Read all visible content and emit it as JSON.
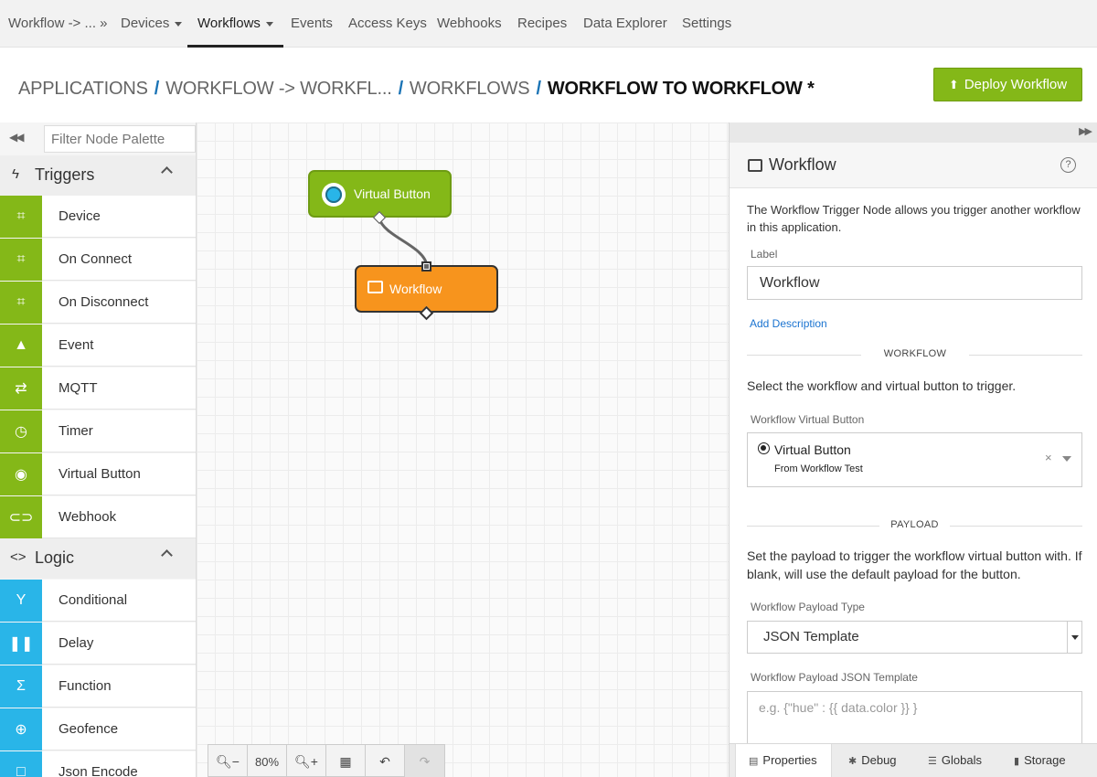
{
  "nav": {
    "items": [
      {
        "label": "Workflow -> ... »",
        "caret": false
      },
      {
        "label": "Devices",
        "caret": true
      },
      {
        "label": "Workflows",
        "caret": true,
        "active": true
      },
      {
        "label": "Events",
        "caret": false
      },
      {
        "label": "Access Keys",
        "caret": false
      },
      {
        "label": "Webhooks",
        "caret": false
      },
      {
        "label": "Recipes",
        "caret": false
      },
      {
        "label": "Data Explorer",
        "caret": false
      },
      {
        "label": "Settings",
        "caret": false
      }
    ]
  },
  "breadcrumb": {
    "items": [
      "APPLICATIONS",
      "WORKFLOW -> WORKFL...",
      "WORKFLOWS"
    ],
    "separator": "/",
    "current": "WORKFLOW TO WORKFLOW *"
  },
  "deploy_button": {
    "label": "Deploy Workflow",
    "icon": "upload-icon"
  },
  "palette": {
    "filter_placeholder": "Filter Node Palette",
    "sections": [
      {
        "title": "Triggers",
        "icon": "lightning-icon",
        "color": "#84b818",
        "items": [
          {
            "label": "Device",
            "icon": "chip-icon"
          },
          {
            "label": "On Connect",
            "icon": "chip-icon"
          },
          {
            "label": "On Disconnect",
            "icon": "chip-icon"
          },
          {
            "label": "Event",
            "icon": "warning-icon"
          },
          {
            "label": "MQTT",
            "icon": "arrows-exchange-icon"
          },
          {
            "label": "Timer",
            "icon": "stopwatch-icon"
          },
          {
            "label": "Virtual Button",
            "icon": "radio-dot-icon"
          },
          {
            "label": "Webhook",
            "icon": "link-icon"
          }
        ]
      },
      {
        "title": "Logic",
        "icon": "code-brackets-icon",
        "color": "#29b5e8",
        "items": [
          {
            "label": "Conditional",
            "icon": "branch-icon"
          },
          {
            "label": "Delay",
            "icon": "pause-icon"
          },
          {
            "label": "Function",
            "icon": "sigma-icon"
          },
          {
            "label": "Geofence",
            "icon": "crosshair-icon"
          },
          {
            "label": "Json Encode",
            "icon": "box-icon"
          }
        ]
      }
    ]
  },
  "canvas": {
    "nodes": [
      {
        "label": "Virtual Button",
        "color": "#84b818",
        "icon": "radio-dot-icon"
      },
      {
        "label": "Workflow",
        "color": "#f7941d",
        "icon": "workflow-enter-icon"
      }
    ],
    "toolbar": {
      "zoom": "80%"
    }
  },
  "panel": {
    "title": "Workflow",
    "description": "The Workflow Trigger Node allows you trigger another workflow in this application.",
    "label_field": {
      "label": "Label",
      "value": "Workflow"
    },
    "add_description": "Add Description",
    "workflow_divider": "WORKFLOW",
    "workflow_help": "Select the workflow and virtual button to trigger.",
    "virtual_button_field": {
      "label": "Workflow Virtual Button",
      "value": "Virtual Button",
      "sublabel": "From Workflow Test",
      "clear": "×"
    },
    "payload_divider": "PAYLOAD",
    "payload_help": "Set the payload to trigger the workflow virtual button with. If blank, will use the default payload for the button.",
    "payload_type_field": {
      "label": "Workflow Payload Type",
      "value": "JSON Template"
    },
    "payload_template_field": {
      "label": "Workflow Payload JSON Template",
      "placeholder": "e.g. {\"hue\" : {{ data.color }} }"
    },
    "tabs": [
      {
        "label": "Properties",
        "icon": "document-icon",
        "active": true
      },
      {
        "label": "Debug",
        "icon": "bug-icon"
      },
      {
        "label": "Globals",
        "icon": "list-icon"
      },
      {
        "label": "Storage",
        "icon": "database-icon"
      }
    ]
  }
}
